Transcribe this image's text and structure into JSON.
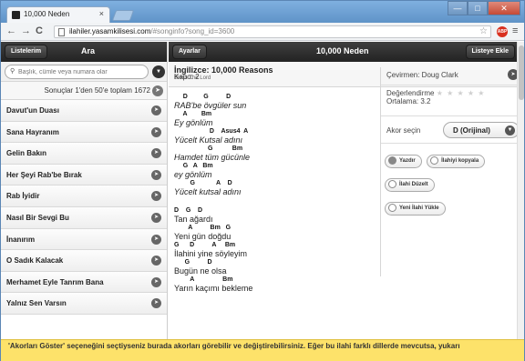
{
  "browser": {
    "tab_title": "10,000 Neden",
    "tab_close": "×",
    "back": "←",
    "forward": "→",
    "reload": "C",
    "url_host": "ilahiler.yasamkilisesi.com",
    "url_path": "/#songinfo?song_id=3600",
    "star": "☆",
    "abp": "ABP",
    "menu": "≡",
    "win_min": "—",
    "win_max": "□",
    "win_close": "✕"
  },
  "sidebar": {
    "list_button": "Listelerim",
    "title": "Ara",
    "search_placeholder": "Başlık, cümle veya numara olar",
    "result_info": "Sonuçlar 1'den 50'e toplam 1672",
    "songs": [
      "Davut'un Duası",
      "Sana Hayranım",
      "Gelin Bakın",
      "Her Şeyi Rab'be Bırak",
      "Rab İyidir",
      "Nasıl Bir Sevgi Bu",
      "İnanırım",
      "O Sadık Kalacak",
      "Merhamet Eyle Tanrım Bana",
      "Yalnız Sen Varsın"
    ]
  },
  "content": {
    "settings_button": "Ayarlar",
    "title": "10,000 Neden",
    "add_to_list_button": "Listeye Ekle",
    "song_title": "İngilizce: 10,000 Reasons",
    "song_author": "Bless The Lord",
    "kapo": "Kapo: 2",
    "stanzas": [
      {
        "lines": [
          {
            "chords": "     D         G          D",
            "text": "RAB'be övgüler sun"
          },
          {
            "chords": "     A        Bm",
            "text": "Ey gönlüm"
          },
          {
            "chords": "                    D    Asus4  A",
            "text": "Yücelt Kutsal adını"
          },
          {
            "chords": "                   G           Bm",
            "text": "Hamdet tüm gücünle"
          },
          {
            "chords": "     G   A   Bm",
            "text": "ey gönlüm"
          },
          {
            "chords": "         G            A    D",
            "text": "Yücelt kutsal adını"
          }
        ]
      },
      {
        "lines": [
          {
            "chords": "D    G    D",
            "text": "Tan ağardı"
          },
          {
            "chords": "        A          Bm   G",
            "text": "Yeni gün doğdu"
          },
          {
            "chords": "G      D          A     Bm",
            "text": "İlahini yine söyleyim"
          },
          {
            "chords": "      G          D",
            "text": "Bugün ne olsa"
          },
          {
            "chords": "         A                Bm",
            "text": "Yarın kaçımı bekleme"
          }
        ]
      }
    ],
    "translator": "Çevirmen: Doug Clark",
    "rating_label": "Değerlendirme",
    "rating_stars": "★ ★ ★ ★ ★",
    "average": "Ortalama: 3.2",
    "akor_label": "Akor seçin",
    "akor_value": "D (Orijinal)",
    "actions": {
      "print": "Yazdır",
      "copy": "İlahiyi kopyala",
      "edit": "İlahi Düzelt",
      "upload": "Yeni İlahi Yükle"
    }
  },
  "footer": {
    "text": "'Akorları Göster' seçeneğini seçtiyseniz burada akorları görebilir ve değiştirebilirsiniz. Eğer bu ilahi farklı dillerde mevcutsa, yukarı"
  }
}
